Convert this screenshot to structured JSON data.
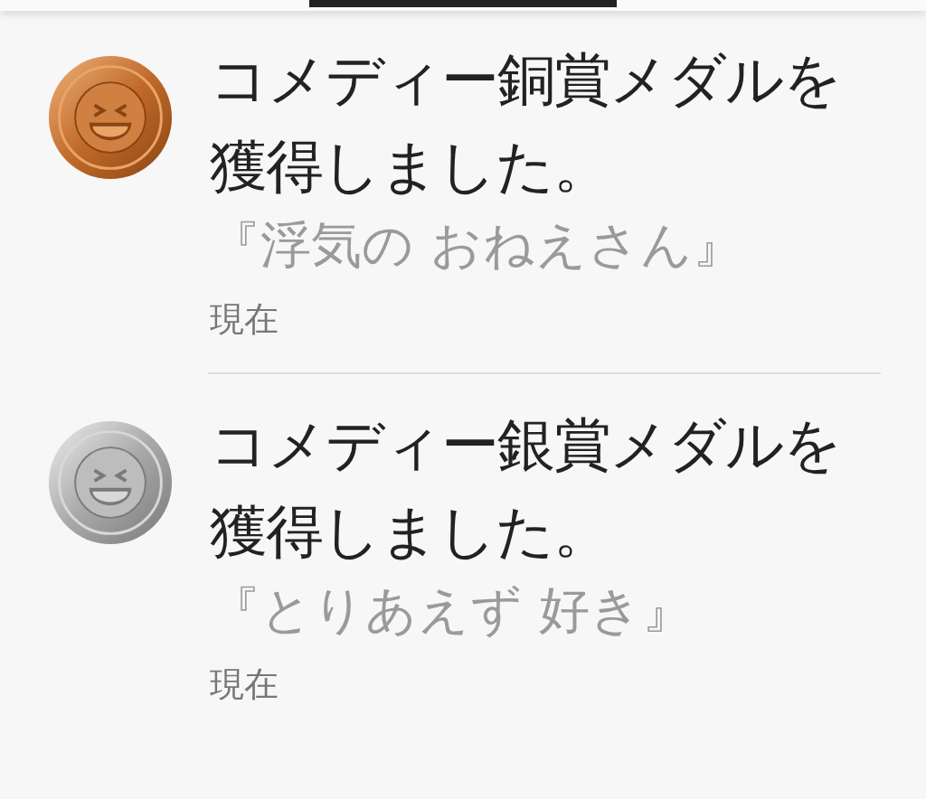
{
  "notifications": [
    {
      "kind": "bronze",
      "message": "コメディー銅賞メダルを獲得しました。",
      "title": "『浮気の おねえさん』",
      "time": "現在"
    },
    {
      "kind": "silver",
      "message": "コメディー銀賞メダルを獲得しました。",
      "title": "『とりあえず 好き』",
      "time": "現在"
    }
  ]
}
